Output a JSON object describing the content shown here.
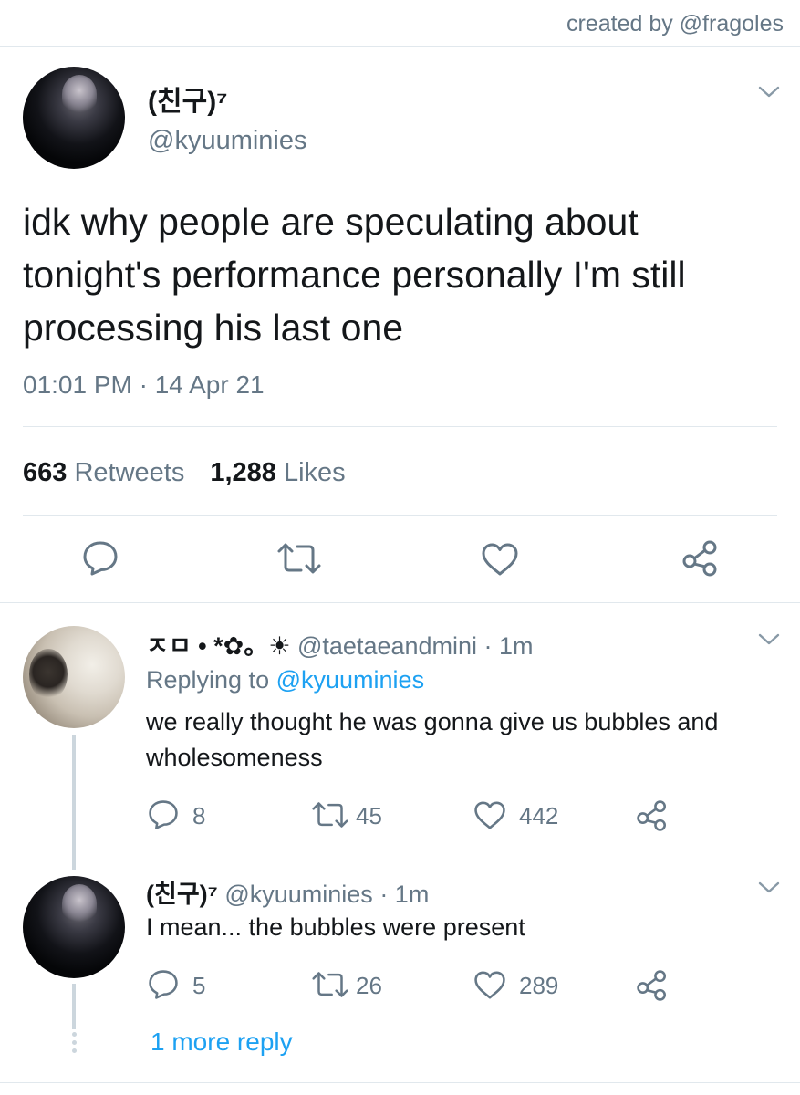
{
  "credit": "created by @fragoles",
  "main_tweet": {
    "name": "(친구)⁷",
    "handle": "@kyuuminies",
    "text": "idk why people are speculating about tonight's performance personally I'm still processing his last one",
    "time": "01:01 PM · 14 Apr 21",
    "retweets_count": "663",
    "retweets_label": "Retweets",
    "likes_count": "1,288",
    "likes_label": "Likes",
    "actions": [
      "reply-icon",
      "retweet-icon",
      "like-icon",
      "share-icon"
    ]
  },
  "replies": [
    {
      "name": "ㅈㅁ • *✿。☀",
      "handle": "@taetaeandmini",
      "time": "· 1m",
      "replying_prefix": "Replying to",
      "replying_to": "@kyuuminies",
      "text": "we really thought he was gonna give us bubbles and wholesomeness",
      "reply_count": "8",
      "retweet_count": "45",
      "like_count": "442"
    },
    {
      "name": "(친구)⁷",
      "handle": "@kyuuminies",
      "time": "· 1m",
      "text": "I mean... the bubbles were present",
      "reply_count": "5",
      "retweet_count": "26",
      "like_count": "289"
    }
  ],
  "more_replies": "1 more reply",
  "colors": {
    "accent": "#1da1f2",
    "text": "#14171a",
    "secondary": "#657786",
    "divider": "#e1e8ed"
  }
}
